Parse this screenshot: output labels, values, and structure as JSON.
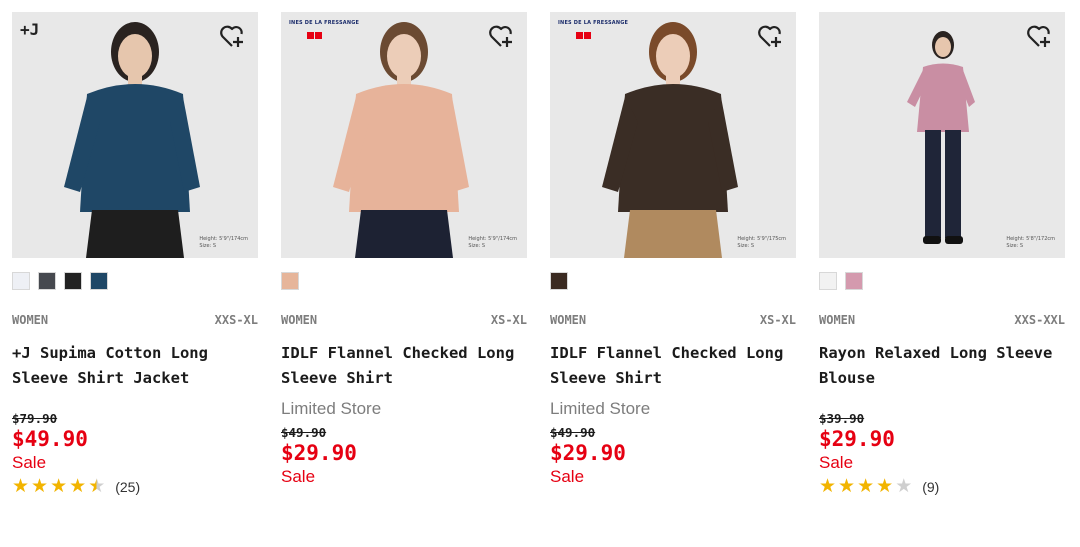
{
  "products": [
    {
      "badge": "+J",
      "brand_tag": "",
      "model_info": [
        "Height: 5'9\"/174cm",
        "Size: S"
      ],
      "colors": [
        "#eef0f5",
        "#46494f",
        "#222222",
        "#1f4766"
      ],
      "gender": "WOMEN",
      "sizes": "XXS-XL",
      "name": "+J Supima Cotton Long Sleeve Shirt Jacket",
      "limited": "",
      "old_price": "$79.90",
      "price": "$49.90",
      "sale": "Sale",
      "rating": 4.5,
      "reviews": "(25)",
      "image_colors": {
        "top": "#1f4766",
        "bottom": "#1e1e1e",
        "skin": "#e6c6ad",
        "hair": "#2a2320"
      }
    },
    {
      "badge": "",
      "brand_tag": "INES DE LA FRESSANGE",
      "model_info": [
        "Height: 5'9\"/174cm",
        "Size: S"
      ],
      "colors": [
        "#e6b59a"
      ],
      "gender": "WOMEN",
      "sizes": "XS-XL",
      "name": "IDLF Flannel Checked Long Sleeve Shirt",
      "limited": "Limited Store",
      "old_price": "$49.90",
      "price": "$29.90",
      "sale": "Sale",
      "rating": null,
      "reviews": "",
      "image_colors": {
        "top": "#e7b39a",
        "bottom": "#1d2233",
        "skin": "#eccdb8",
        "hair": "#6b4a32"
      }
    },
    {
      "badge": "",
      "brand_tag": "INES DE LA FRESSANGE",
      "model_info": [
        "Height: 5'9\"/175cm",
        "Size: S"
      ],
      "colors": [
        "#3b2b22"
      ],
      "gender": "WOMEN",
      "sizes": "XS-XL",
      "name": "IDLF Flannel Checked Long Sleeve Shirt",
      "limited": "Limited Store",
      "old_price": "$49.90",
      "price": "$29.90",
      "sale": "Sale",
      "rating": null,
      "reviews": "",
      "image_colors": {
        "top": "#3a2d25",
        "bottom": "#b08a5f",
        "skin": "#eccdb8",
        "hair": "#7a4a2a"
      }
    },
    {
      "badge": "",
      "brand_tag": "",
      "model_info": [
        "Height: 5'8\"/172cm",
        "Size: S"
      ],
      "colors": [
        "#f2f2f2",
        "#d49aae"
      ],
      "gender": "WOMEN",
      "sizes": "XXS-XXL",
      "name": "Rayon Relaxed Long Sleeve Blouse",
      "limited": "",
      "old_price": "$39.90",
      "price": "$29.90",
      "sale": "Sale",
      "rating": 4,
      "reviews": "(9)",
      "image_colors": {
        "top": "#c98ea3",
        "bottom": "#1f2538",
        "skin": "#e6c6ad",
        "hair": "#2a2320"
      }
    }
  ]
}
